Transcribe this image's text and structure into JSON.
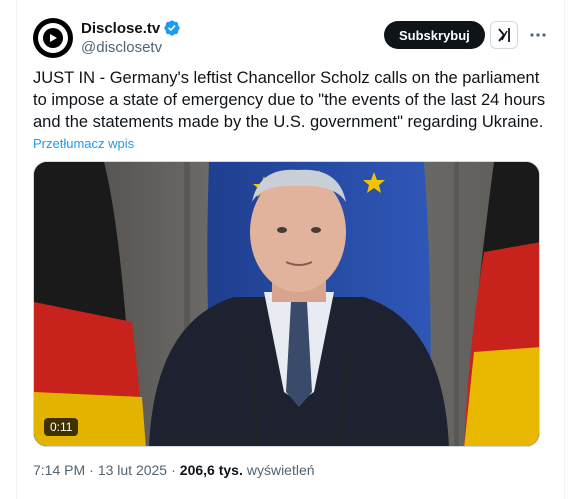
{
  "account": {
    "display_name": "Disclose.tv",
    "handle": "@disclosetv",
    "verified": true
  },
  "actions": {
    "subscribe_label": "Subskrybuj",
    "grok_icon": "grok-icon",
    "more_icon": "more-icon"
  },
  "tweet": {
    "text": "JUST IN - Germany's leftist Chancellor Scholz calls on the parliament to impose a state of emergency due to \"the events of the last 24 hours and the statements made by the U.S. government\" regarding Ukraine.",
    "translate_label": "Przetłumacz wpis"
  },
  "media": {
    "type": "video",
    "duration": "0:11"
  },
  "meta": {
    "time": "7:14 PM",
    "separator": "·",
    "date": "13 lut 2025",
    "views_count": "206,6 tys.",
    "views_label": "wyświetleń"
  },
  "colors": {
    "accent": "#1d9bf0",
    "text": "#0f1419",
    "muted": "#536471",
    "button_bg": "#0f1419"
  }
}
